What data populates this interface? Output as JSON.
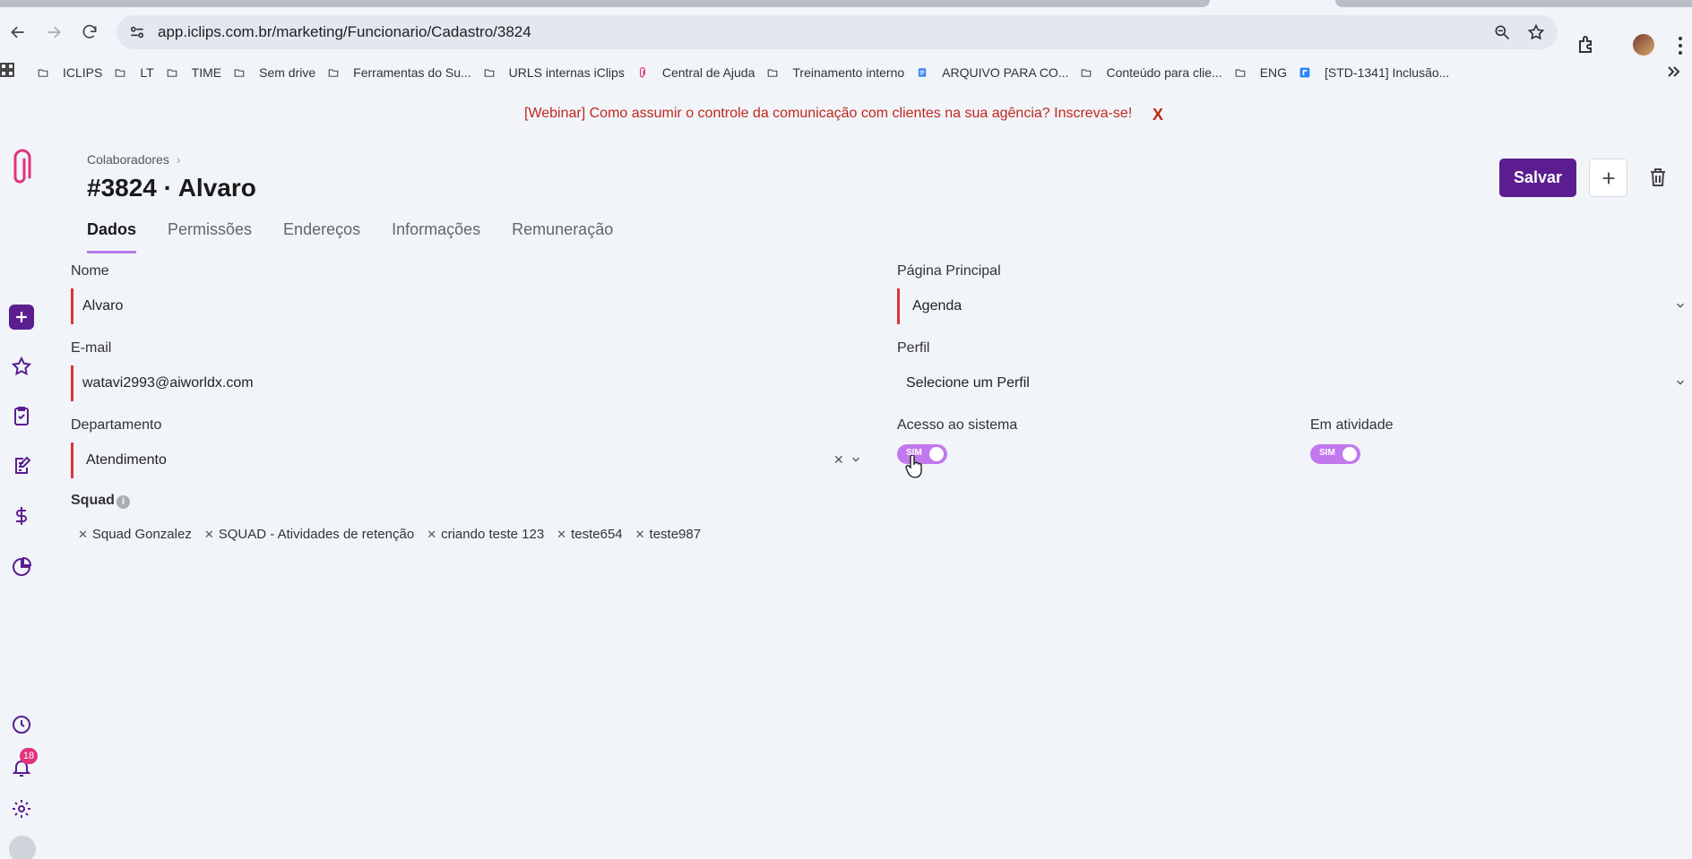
{
  "browser": {
    "url": "app.iclips.com.br/marketing/Funcionario/Cadastro/3824",
    "bookmarks": [
      {
        "label": "ICLIPS",
        "icon": "folder-icon"
      },
      {
        "label": "LT",
        "icon": "folder-icon"
      },
      {
        "label": "TIME",
        "icon": "folder-icon"
      },
      {
        "label": "Sem drive",
        "icon": "folder-icon"
      },
      {
        "label": "Ferramentas do Su...",
        "icon": "folder-icon"
      },
      {
        "label": "URLS internas iClips",
        "icon": "folder-icon"
      },
      {
        "label": "Central de Ajuda",
        "icon": "paperclip-icon"
      },
      {
        "label": "Treinamento interno",
        "icon": "folder-icon"
      },
      {
        "label": "ARQUIVO PARA CO...",
        "icon": "doc-icon"
      },
      {
        "label": "Conteúdo para clie...",
        "icon": "folder-icon"
      },
      {
        "label": "ENG",
        "icon": "folder-icon"
      },
      {
        "label": "[STD-1341] Inclusão...",
        "icon": "jira-icon"
      }
    ]
  },
  "banner": {
    "text": "[Webinar] Como assumir o controle da comunicação com clientes na sua agência? Inscreva-se!",
    "close": "X",
    "color": "#c0281d"
  },
  "sidebar": {
    "notification_count": "18",
    "brand_color": "#5b1d8f",
    "accent_color": "#e0337d"
  },
  "header": {
    "breadcrumb": "Colaboradores",
    "title": "#3824 · Alvaro",
    "save_label": "Salvar"
  },
  "tabs": [
    {
      "label": "Dados",
      "active": true
    },
    {
      "label": "Permissões"
    },
    {
      "label": "Endereços"
    },
    {
      "label": "Informações"
    },
    {
      "label": "Remuneração"
    }
  ],
  "form": {
    "nome": {
      "label": "Nome",
      "value": "Alvaro"
    },
    "email": {
      "label": "E-mail",
      "value": "watavi2993@aiworldx.com"
    },
    "departamento": {
      "label": "Departamento",
      "value": "Atendimento"
    },
    "pagina_principal": {
      "label": "Página Principal",
      "value": "Agenda"
    },
    "perfil": {
      "label": "Perfil",
      "value": "Selecione um Perfil"
    },
    "acesso": {
      "label": "Acesso ao sistema",
      "toggle": "SIM",
      "on": true
    },
    "atividade": {
      "label": "Em atividade",
      "toggle": "SIM",
      "on": true
    },
    "squad": {
      "label": "Squad",
      "info": "i",
      "chips": [
        "Squad Gonzalez",
        "SQUAD - Atividades de retenção",
        "criando teste 123",
        "teste654",
        "teste987"
      ]
    }
  }
}
